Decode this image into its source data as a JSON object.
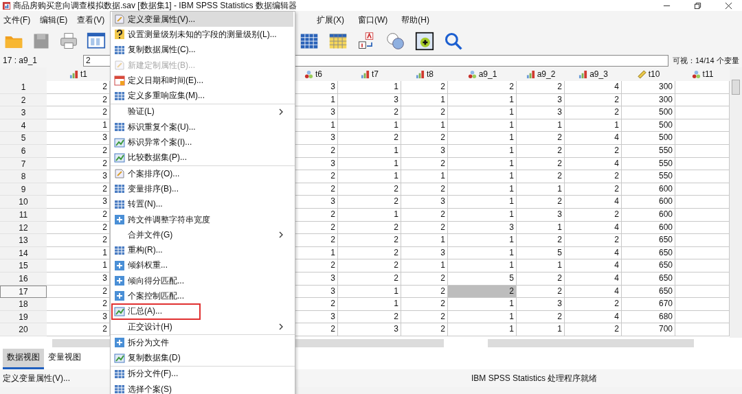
{
  "window": {
    "title": "商品房购买意向调查模拟数据.sav [数据集1] - IBM SPSS Statistics 数据编辑器"
  },
  "menubar": [
    {
      "label": "文件(F)"
    },
    {
      "label": "编辑(E)"
    },
    {
      "label": "查看(V)"
    },
    {
      "label": "扩展(X)"
    },
    {
      "label": "窗口(W)"
    },
    {
      "label": "帮助(H)"
    }
  ],
  "cell_bar": {
    "reference": "17 : a9_1",
    "value": "2",
    "visible": "可视：14/14 个变量"
  },
  "table": {
    "columns": [
      {
        "name": "t1",
        "kind": "ordinal"
      },
      {
        "name": "t6",
        "kind": "nominal"
      },
      {
        "name": "t7",
        "kind": "ordinal"
      },
      {
        "name": "t8",
        "kind": "ordinal"
      },
      {
        "name": "a9_1",
        "kind": "nominal"
      },
      {
        "name": "a9_2",
        "kind": "ordinal"
      },
      {
        "name": "a9_3",
        "kind": "ordinal"
      },
      {
        "name": "t10",
        "kind": "scale"
      },
      {
        "name": "t11",
        "kind": "nominal"
      }
    ],
    "rows": [
      {
        "number": "1",
        "selected": false,
        "cells": [
          {
            "value": "2",
            "selected": false
          },
          {
            "value": "3",
            "selected": false
          },
          {
            "value": "1",
            "selected": false
          },
          {
            "value": "2",
            "selected": false
          },
          {
            "value": "2",
            "selected": false
          },
          {
            "value": "2",
            "selected": false
          },
          {
            "value": "4",
            "selected": false
          },
          {
            "value": "300",
            "selected": false
          }
        ]
      },
      {
        "number": "2",
        "selected": false,
        "cells": [
          {
            "value": "2",
            "selected": false
          },
          {
            "value": "1",
            "selected": false
          },
          {
            "value": "3",
            "selected": false
          },
          {
            "value": "1",
            "selected": false
          },
          {
            "value": "1",
            "selected": false
          },
          {
            "value": "3",
            "selected": false
          },
          {
            "value": "2",
            "selected": false
          },
          {
            "value": "300",
            "selected": false
          }
        ]
      },
      {
        "number": "3",
        "selected": false,
        "cells": [
          {
            "value": "2",
            "selected": false
          },
          {
            "value": "3",
            "selected": false
          },
          {
            "value": "2",
            "selected": false
          },
          {
            "value": "2",
            "selected": false
          },
          {
            "value": "1",
            "selected": false
          },
          {
            "value": "3",
            "selected": false
          },
          {
            "value": "2",
            "selected": false
          },
          {
            "value": "500",
            "selected": false
          }
        ]
      },
      {
        "number": "4",
        "selected": false,
        "cells": [
          {
            "value": "1",
            "selected": false
          },
          {
            "value": "1",
            "selected": false
          },
          {
            "value": "1",
            "selected": false
          },
          {
            "value": "1",
            "selected": false
          },
          {
            "value": "1",
            "selected": false
          },
          {
            "value": "1",
            "selected": false
          },
          {
            "value": "1",
            "selected": false
          },
          {
            "value": "500",
            "selected": false
          }
        ]
      },
      {
        "number": "5",
        "selected": false,
        "cells": [
          {
            "value": "3",
            "selected": false
          },
          {
            "value": "3",
            "selected": false
          },
          {
            "value": "2",
            "selected": false
          },
          {
            "value": "2",
            "selected": false
          },
          {
            "value": "1",
            "selected": false
          },
          {
            "value": "2",
            "selected": false
          },
          {
            "value": "4",
            "selected": false
          },
          {
            "value": "500",
            "selected": false
          }
        ]
      },
      {
        "number": "6",
        "selected": false,
        "cells": [
          {
            "value": "2",
            "selected": false
          },
          {
            "value": "2",
            "selected": false
          },
          {
            "value": "1",
            "selected": false
          },
          {
            "value": "3",
            "selected": false
          },
          {
            "value": "1",
            "selected": false
          },
          {
            "value": "2",
            "selected": false
          },
          {
            "value": "2",
            "selected": false
          },
          {
            "value": "550",
            "selected": false
          }
        ]
      },
      {
        "number": "7",
        "selected": false,
        "cells": [
          {
            "value": "2",
            "selected": false
          },
          {
            "value": "3",
            "selected": false
          },
          {
            "value": "1",
            "selected": false
          },
          {
            "value": "2",
            "selected": false
          },
          {
            "value": "1",
            "selected": false
          },
          {
            "value": "2",
            "selected": false
          },
          {
            "value": "4",
            "selected": false
          },
          {
            "value": "550",
            "selected": false
          }
        ]
      },
      {
        "number": "8",
        "selected": false,
        "cells": [
          {
            "value": "3",
            "selected": false
          },
          {
            "value": "2",
            "selected": false
          },
          {
            "value": "1",
            "selected": false
          },
          {
            "value": "1",
            "selected": false
          },
          {
            "value": "1",
            "selected": false
          },
          {
            "value": "2",
            "selected": false
          },
          {
            "value": "2",
            "selected": false
          },
          {
            "value": "550",
            "selected": false
          }
        ]
      },
      {
        "number": "9",
        "selected": false,
        "cells": [
          {
            "value": "2",
            "selected": false
          },
          {
            "value": "2",
            "selected": false
          },
          {
            "value": "2",
            "selected": false
          },
          {
            "value": "2",
            "selected": false
          },
          {
            "value": "1",
            "selected": false
          },
          {
            "value": "1",
            "selected": false
          },
          {
            "value": "2",
            "selected": false
          },
          {
            "value": "600",
            "selected": false
          }
        ]
      },
      {
        "number": "10",
        "selected": false,
        "cells": [
          {
            "value": "3",
            "selected": false
          },
          {
            "value": "3",
            "selected": false
          },
          {
            "value": "2",
            "selected": false
          },
          {
            "value": "3",
            "selected": false
          },
          {
            "value": "1",
            "selected": false
          },
          {
            "value": "2",
            "selected": false
          },
          {
            "value": "4",
            "selected": false
          },
          {
            "value": "600",
            "selected": false
          }
        ]
      },
      {
        "number": "11",
        "selected": false,
        "cells": [
          {
            "value": "2",
            "selected": false
          },
          {
            "value": "2",
            "selected": false
          },
          {
            "value": "1",
            "selected": false
          },
          {
            "value": "2",
            "selected": false
          },
          {
            "value": "1",
            "selected": false
          },
          {
            "value": "3",
            "selected": false
          },
          {
            "value": "2",
            "selected": false
          },
          {
            "value": "600",
            "selected": false
          }
        ]
      },
      {
        "number": "12",
        "selected": false,
        "cells": [
          {
            "value": "2",
            "selected": false
          },
          {
            "value": "2",
            "selected": false
          },
          {
            "value": "2",
            "selected": false
          },
          {
            "value": "2",
            "selected": false
          },
          {
            "value": "3",
            "selected": false
          },
          {
            "value": "1",
            "selected": false
          },
          {
            "value": "4",
            "selected": false
          },
          {
            "value": "600",
            "selected": false
          }
        ]
      },
      {
        "number": "13",
        "selected": false,
        "cells": [
          {
            "value": "2",
            "selected": false
          },
          {
            "value": "2",
            "selected": false
          },
          {
            "value": "2",
            "selected": false
          },
          {
            "value": "1",
            "selected": false
          },
          {
            "value": "1",
            "selected": false
          },
          {
            "value": "2",
            "selected": false
          },
          {
            "value": "2",
            "selected": false
          },
          {
            "value": "650",
            "selected": false
          }
        ]
      },
      {
        "number": "14",
        "selected": false,
        "cells": [
          {
            "value": "1",
            "selected": false
          },
          {
            "value": "1",
            "selected": false
          },
          {
            "value": "2",
            "selected": false
          },
          {
            "value": "3",
            "selected": false
          },
          {
            "value": "1",
            "selected": false
          },
          {
            "value": "5",
            "selected": false
          },
          {
            "value": "4",
            "selected": false
          },
          {
            "value": "650",
            "selected": false
          }
        ]
      },
      {
        "number": "15",
        "selected": false,
        "cells": [
          {
            "value": "1",
            "selected": false
          },
          {
            "value": "2",
            "selected": false
          },
          {
            "value": "2",
            "selected": false
          },
          {
            "value": "1",
            "selected": false
          },
          {
            "value": "1",
            "selected": false
          },
          {
            "value": "1",
            "selected": false
          },
          {
            "value": "4",
            "selected": false
          },
          {
            "value": "650",
            "selected": false
          }
        ]
      },
      {
        "number": "16",
        "selected": false,
        "cells": [
          {
            "value": "3",
            "selected": false
          },
          {
            "value": "3",
            "selected": false
          },
          {
            "value": "2",
            "selected": false
          },
          {
            "value": "2",
            "selected": false
          },
          {
            "value": "5",
            "selected": false
          },
          {
            "value": "2",
            "selected": false
          },
          {
            "value": "4",
            "selected": false
          },
          {
            "value": "650",
            "selected": false
          }
        ]
      },
      {
        "number": "17",
        "selected": true,
        "cells": [
          {
            "value": "2",
            "selected": false
          },
          {
            "value": "3",
            "selected": false
          },
          {
            "value": "1",
            "selected": false
          },
          {
            "value": "2",
            "selected": false
          },
          {
            "value": "2",
            "selected": true
          },
          {
            "value": "2",
            "selected": false
          },
          {
            "value": "4",
            "selected": false
          },
          {
            "value": "650",
            "selected": false
          }
        ]
      },
      {
        "number": "18",
        "selected": false,
        "cells": [
          {
            "value": "2",
            "selected": false
          },
          {
            "value": "2",
            "selected": false
          },
          {
            "value": "1",
            "selected": false
          },
          {
            "value": "2",
            "selected": false
          },
          {
            "value": "1",
            "selected": false
          },
          {
            "value": "3",
            "selected": false
          },
          {
            "value": "2",
            "selected": false
          },
          {
            "value": "670",
            "selected": false
          }
        ]
      },
      {
        "number": "19",
        "selected": false,
        "cells": [
          {
            "value": "3",
            "selected": false
          },
          {
            "value": "3",
            "selected": false
          },
          {
            "value": "2",
            "selected": false
          },
          {
            "value": "2",
            "selected": false
          },
          {
            "value": "1",
            "selected": false
          },
          {
            "value": "2",
            "selected": false
          },
          {
            "value": "4",
            "selected": false
          },
          {
            "value": "680",
            "selected": false
          }
        ]
      },
      {
        "number": "20",
        "selected": false,
        "cells": [
          {
            "value": "2",
            "selected": false
          },
          {
            "value": "2",
            "selected": false
          },
          {
            "value": "3",
            "selected": false
          },
          {
            "value": "2",
            "selected": false
          },
          {
            "value": "1",
            "selected": false
          },
          {
            "value": "1",
            "selected": false
          },
          {
            "value": "2",
            "selected": false
          },
          {
            "value": "700",
            "selected": false
          }
        ]
      }
    ]
  },
  "menu": {
    "items": [
      {
        "kind": "item",
        "label": "定义变量属性(V)...",
        "highlighted": true,
        "disabled": false,
        "submenu": false,
        "marked": false
      },
      {
        "kind": "item",
        "label": "设置测量级别未知的字段的测量级别(L)...",
        "highlighted": false,
        "disabled": false,
        "submenu": false,
        "marked": false
      },
      {
        "kind": "item",
        "label": "复制数据属性(C)...",
        "highlighted": false,
        "disabled": false,
        "submenu": false,
        "marked": false
      },
      {
        "kind": "item",
        "label": "新建定制属性(B)...",
        "highlighted": false,
        "disabled": true,
        "submenu": false,
        "marked": false
      },
      {
        "kind": "item",
        "label": "定义日期和时间(E)...",
        "highlighted": false,
        "disabled": false,
        "submenu": false,
        "marked": false
      },
      {
        "kind": "item",
        "label": "定义多重响应集(M)...",
        "highlighted": false,
        "disabled": false,
        "submenu": false,
        "marked": false
      },
      {
        "kind": "separator"
      },
      {
        "kind": "item",
        "label": "验证(L)",
        "highlighted": false,
        "disabled": false,
        "submenu": true,
        "marked": false
      },
      {
        "kind": "item",
        "label": "标识重复个案(U)...",
        "highlighted": false,
        "disabled": false,
        "submenu": false,
        "marked": false
      },
      {
        "kind": "item",
        "label": "标识异常个案(I)...",
        "highlighted": false,
        "disabled": false,
        "submenu": false,
        "marked": false
      },
      {
        "kind": "item",
        "label": "比较数据集(P)...",
        "highlighted": false,
        "disabled": false,
        "submenu": false,
        "marked": false
      },
      {
        "kind": "separator"
      },
      {
        "kind": "item",
        "label": "个案排序(O)...",
        "highlighted": false,
        "disabled": false,
        "submenu": false,
        "marked": false
      },
      {
        "kind": "item",
        "label": "变量排序(B)...",
        "highlighted": false,
        "disabled": false,
        "submenu": false,
        "marked": false
      },
      {
        "kind": "item",
        "label": "转置(N)...",
        "highlighted": false,
        "disabled": false,
        "submenu": false,
        "marked": false
      },
      {
        "kind": "item",
        "label": "跨文件调整字符串宽度",
        "highlighted": false,
        "disabled": false,
        "submenu": false,
        "marked": false
      },
      {
        "kind": "item",
        "label": "合并文件(G)",
        "highlighted": false,
        "disabled": false,
        "submenu": true,
        "marked": false
      },
      {
        "kind": "item",
        "label": "重构(R)...",
        "highlighted": false,
        "disabled": false,
        "submenu": false,
        "marked": false
      },
      {
        "kind": "item",
        "label": "倾斜权重...",
        "highlighted": false,
        "disabled": false,
        "submenu": false,
        "marked": false
      },
      {
        "kind": "item",
        "label": "倾向得分匹配...",
        "highlighted": false,
        "disabled": false,
        "submenu": false,
        "marked": false
      },
      {
        "kind": "item",
        "label": "个案控制匹配...",
        "highlighted": false,
        "disabled": false,
        "submenu": false,
        "marked": false
      },
      {
        "kind": "item",
        "label": "汇总(A)...",
        "highlighted": false,
        "disabled": false,
        "submenu": false,
        "marked": true
      },
      {
        "kind": "item",
        "label": "正交设计(H)",
        "highlighted": false,
        "disabled": false,
        "submenu": true,
        "marked": false
      },
      {
        "kind": "separator"
      },
      {
        "kind": "item",
        "label": "拆分为文件",
        "highlighted": false,
        "disabled": false,
        "submenu": false,
        "marked": false
      },
      {
        "kind": "item",
        "label": "复制数据集(D)",
        "highlighted": false,
        "disabled": false,
        "submenu": false,
        "marked": false
      },
      {
        "kind": "separator"
      },
      {
        "kind": "item",
        "label": "拆分文件(F)...",
        "highlighted": false,
        "disabled": false,
        "submenu": false,
        "marked": false
      },
      {
        "kind": "item",
        "label": "选择个案(S)",
        "highlighted": false,
        "disabled": false,
        "submenu": false,
        "marked": false
      }
    ]
  },
  "view_tabs": [
    {
      "label": "数据视图",
      "selected": true
    },
    {
      "label": "变量视图",
      "selected": false
    }
  ],
  "status_bar": {
    "message": "定义变量属性(V)...",
    "state": "IBM SPSS Statistics 处理程序就绪"
  }
}
